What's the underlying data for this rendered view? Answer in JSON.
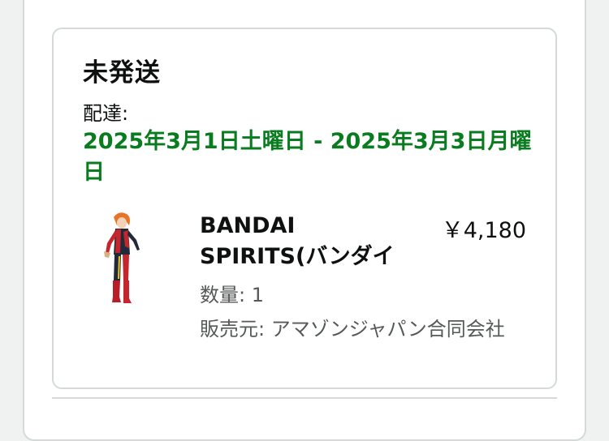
{
  "shipment": {
    "status": "未発送",
    "delivery_label": "配達:",
    "delivery_date": "2025年3月1日土曜日 - 2025年3月3日月曜日"
  },
  "item": {
    "title": "BANDAI SPIRITS(バンダイ",
    "price": "￥4,180",
    "quantity": "数量: 1",
    "seller": "販売元: アマゾンジャパン合同会社",
    "image_icon": "figure-product-image"
  },
  "colors": {
    "delivery_green": "#0a7c20",
    "text_primary": "#0f1111",
    "text_secondary": "#565959",
    "border": "#d5d9d9"
  }
}
